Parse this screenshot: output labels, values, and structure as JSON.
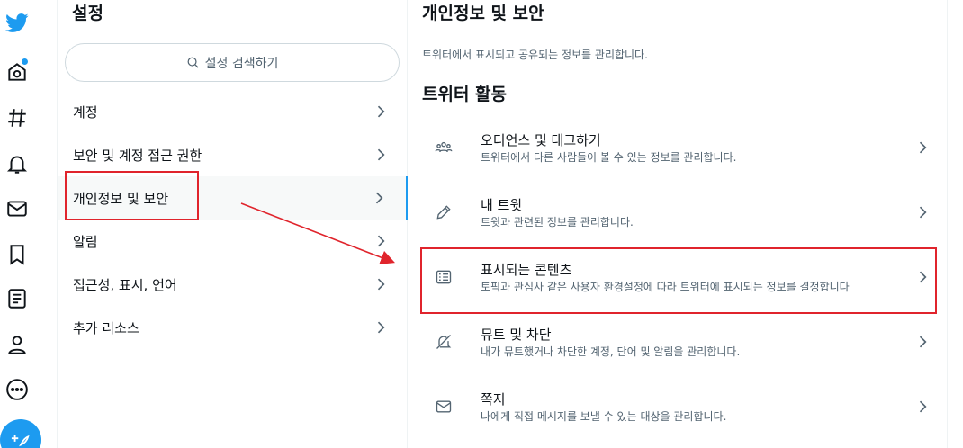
{
  "nav": {
    "items": [
      {
        "name": "twitter-logo-icon"
      },
      {
        "name": "home-icon"
      },
      {
        "name": "explore-hashtag-icon"
      },
      {
        "name": "notifications-bell-icon"
      },
      {
        "name": "messages-envelope-icon"
      },
      {
        "name": "bookmarks-icon"
      },
      {
        "name": "lists-icon"
      },
      {
        "name": "profile-icon"
      },
      {
        "name": "more-icon"
      }
    ],
    "brand_color": "#1d9bf0"
  },
  "settings": {
    "title": "설정",
    "search_placeholder": "설정 검색하기",
    "menu": [
      {
        "label": "계정"
      },
      {
        "label": "보안 및 계정 접근 권한"
      },
      {
        "label": "개인정보 및 보안",
        "active": true
      },
      {
        "label": "알림"
      },
      {
        "label": "접근성, 표시, 언어"
      },
      {
        "label": "추가 리소스"
      }
    ]
  },
  "content": {
    "title": "개인정보 및 보안",
    "description": "트위터에서 표시되고 공유되는 정보를 관리합니다.",
    "section_title": "트위터 활동",
    "rows": [
      {
        "icon": "audience-people-icon",
        "title": "오디언스 및 태그하기",
        "desc": "트위터에서 다른 사람들이 볼 수 있는 정보를 관리합니다."
      },
      {
        "icon": "pencil-icon",
        "title": "내 트윗",
        "desc": "트윗과 관련된 정보를 관리합니다."
      },
      {
        "icon": "content-list-icon",
        "title": "표시되는 콘텐츠",
        "desc": "토픽과 관심사 같은 사용자 환경설정에 따라 트위터에 표시되는 정보를 결정합니다"
      },
      {
        "icon": "mute-icon",
        "title": "뮤트 및 차단",
        "desc": "내가 뮤트했거나 차단한 계정, 단어 및 알림을 관리합니다."
      },
      {
        "icon": "envelope-icon",
        "title": "쪽지",
        "desc": "나에게 직접 메시지를 보낼 수 있는 대상을 관리합니다."
      }
    ]
  },
  "annotation_color": "#e0242c"
}
